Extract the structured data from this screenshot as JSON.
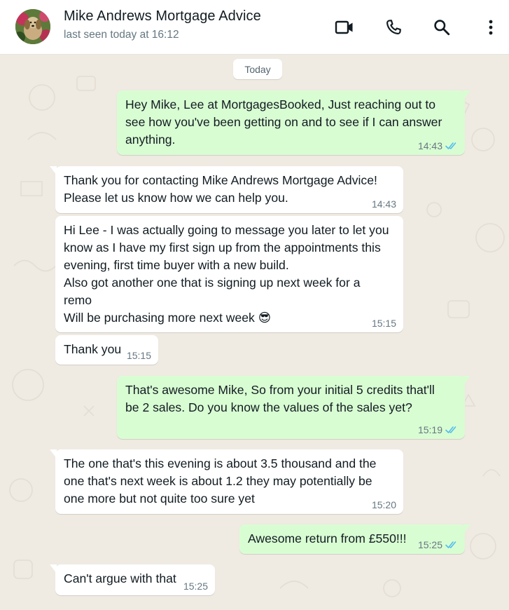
{
  "header": {
    "contact_name": "Mike Andrews Mortgage Advice",
    "last_seen": "last seen today at 16:12",
    "icons": [
      "video-call-icon",
      "voice-call-icon",
      "search-icon",
      "more-options-icon"
    ]
  },
  "chat": {
    "date_label": "Today",
    "messages": [
      {
        "direction": "outgoing",
        "text": "Hey Mike, Lee at MortgagesBooked, Just reaching out to\nsee how you've been getting on and to see if I can answer\nanything.",
        "time": "14:43",
        "status": "read"
      },
      {
        "direction": "incoming",
        "text": "Thank you for contacting Mike Andrews Mortgage Advice!\nPlease let us know how we can help you.",
        "time": "14:43"
      },
      {
        "direction": "incoming",
        "text": "Hi Lee - I was actually going to message you later to let you\nknow as I have my first sign up from the appointments this\nevening, first time buyer with a new build.\nAlso got another one that is signing up next week for a\nremo\nWill be purchasing more next week",
        "emoji": "😎",
        "time": "15:15"
      },
      {
        "direction": "incoming",
        "text": "Thank you",
        "time": "15:15"
      },
      {
        "direction": "outgoing",
        "text": "That's awesome Mike, So from your initial 5 credits that'll\nbe 2 sales. Do you know the values of the sales yet?",
        "time": "15:19",
        "status": "read"
      },
      {
        "direction": "incoming",
        "text": "The one that's this evening is about 3.5 thousand and the\none that's next week is about 1.2 they may potentially be\none more but not quite too sure yet",
        "time": "15:20"
      },
      {
        "direction": "outgoing",
        "text": "Awesome return from £550!!!",
        "time": "15:25",
        "status": "read"
      },
      {
        "direction": "incoming",
        "text": "Can't argue with that",
        "time": "15:25"
      }
    ]
  },
  "colors": {
    "outgoing_bubble": "#d9fdd3",
    "incoming_bubble": "#ffffff",
    "chat_background": "#efeae2",
    "read_ticks": "#53bdeb",
    "meta_text": "#667781"
  }
}
